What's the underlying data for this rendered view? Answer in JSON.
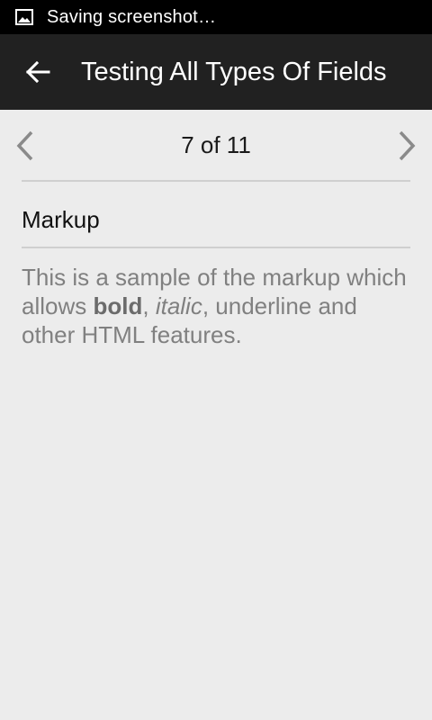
{
  "status_bar": {
    "notification_icon": "image-icon",
    "text": "Saving screenshot…"
  },
  "app_bar": {
    "back_icon": "arrow-back-icon",
    "title": "Testing All Types Of Fields"
  },
  "pager": {
    "prev_icon": "chevron-left-icon",
    "next_icon": "chevron-right-icon",
    "label": "7 of 11"
  },
  "field": {
    "title": "Markup",
    "body": {
      "prefix": "This is a sample of the markup which allows ",
      "bold": "bold",
      "sep1": ", ",
      "italic": "italic",
      "suffix": ", underline and other HTML features."
    }
  },
  "colors": {
    "status_bar_bg": "#000000",
    "app_bar_bg": "#212121",
    "page_bg": "#ececec",
    "divider": "#cfcfcf",
    "body_text": "#808080"
  }
}
